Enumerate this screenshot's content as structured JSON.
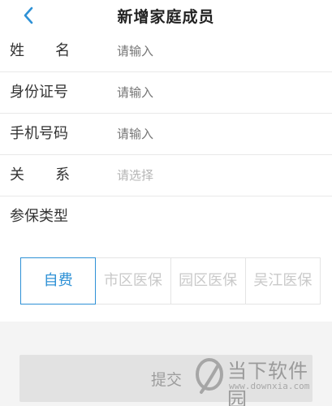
{
  "header": {
    "title": "新增家庭成员",
    "back_icon": "chevron-left-icon"
  },
  "form": {
    "name": {
      "label": "姓  名",
      "placeholder": "请输入"
    },
    "id_number": {
      "label": "身份证号",
      "placeholder": "请输入"
    },
    "phone": {
      "label": "手机号码",
      "placeholder": "请输入"
    },
    "relation": {
      "label": "关  系",
      "placeholder": "请选择"
    },
    "insurance_type": {
      "label": "参保类型"
    }
  },
  "insurance_options": [
    {
      "label": "自费",
      "selected": true
    },
    {
      "label": "市区医保",
      "selected": false
    },
    {
      "label": "园区医保",
      "selected": false
    },
    {
      "label": "吴江医保",
      "selected": false
    }
  ],
  "submit_label": "提交",
  "watermark": {
    "text": "当下软件园",
    "url": "www.downxia.com"
  },
  "colors": {
    "accent": "#2e91d6",
    "placeholder": "#b5b5b5",
    "disabled_button": "#e2e2e2"
  }
}
